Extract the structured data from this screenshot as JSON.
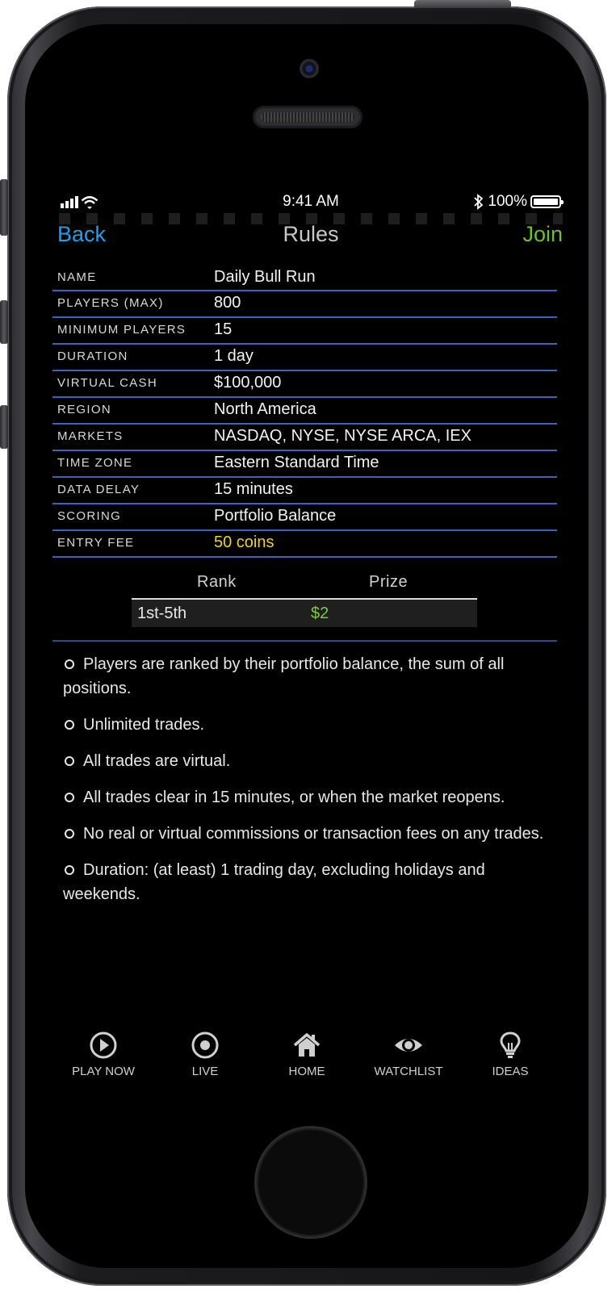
{
  "status_bar": {
    "time": "9:41 AM",
    "battery": "100%"
  },
  "nav": {
    "back": "Back",
    "title": "Rules",
    "join": "Join"
  },
  "rules": [
    {
      "label": "NAME",
      "value": "Daily Bull Run"
    },
    {
      "label": "PLAYERS (MAX)",
      "value": "800"
    },
    {
      "label": "MINIMUM PLAYERS",
      "value": "15"
    },
    {
      "label": "DURATION",
      "value": "1 day"
    },
    {
      "label": "VIRTUAL CASH",
      "value": "$100,000"
    },
    {
      "label": "REGION",
      "value": "North America"
    },
    {
      "label": "MARKETS",
      "value": "NASDAQ, NYSE, NYSE ARCA, IEX"
    },
    {
      "label": "TIME ZONE",
      "value": "Eastern Standard Time"
    },
    {
      "label": "DATA DELAY",
      "value": "15 minutes"
    },
    {
      "label": "SCORING",
      "value": "Portfolio Balance"
    },
    {
      "label": "ENTRY FEE",
      "value": "50 coins"
    }
  ],
  "prizes": {
    "rank_header": "Rank",
    "prize_header": "Prize",
    "rows": [
      {
        "rank": "1st-5th",
        "prize": "$2"
      }
    ]
  },
  "bullets": [
    "Players are ranked by their portfolio balance, the sum of all positions.",
    "Unlimited trades.",
    "All trades are virtual.",
    "All trades clear in 15 minutes, or when the market reopens.",
    "No real or virtual commissions or transaction fees on any trades.",
    "Duration: (at least) 1 trading day, excluding holidays and weekends."
  ],
  "tabs": [
    {
      "label": "PLAY NOW",
      "icon": "play-icon"
    },
    {
      "label": "LIVE",
      "icon": "live-target-icon"
    },
    {
      "label": "HOME",
      "icon": "home-icon"
    },
    {
      "label": "WATCHLIST",
      "icon": "eye-icon"
    },
    {
      "label": "IDEAS",
      "icon": "lightbulb-icon"
    }
  ],
  "colors": {
    "back": "#1ea0ee",
    "join": "#6fbf2c",
    "row_divider": "#3a63c0",
    "entry_fee": "#f2d21c",
    "prize_value": "#7fc943"
  }
}
